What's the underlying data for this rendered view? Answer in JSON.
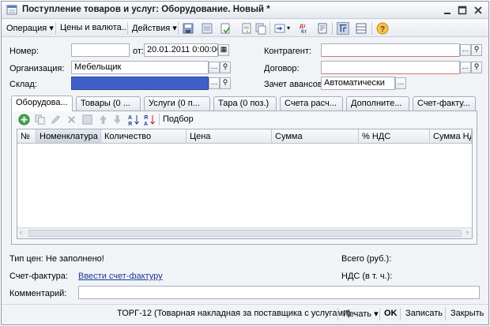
{
  "window": {
    "title": "Поступление товаров и услуг: Оборудование. Новый *"
  },
  "toolbar": {
    "operation": "Операция",
    "prices": "Цены и валюта...",
    "actions": "Действия"
  },
  "header": {
    "number_label": "Номер:",
    "number_value": "",
    "date_label": "от:",
    "date_value": "20.01.2011  0:00:00",
    "org_label": "Организация:",
    "org_value": "Мебельщик",
    "warehouse_label": "Склад:",
    "warehouse_value": "",
    "counterparty_label": "Контрагент:",
    "counterparty_value": "",
    "contract_label": "Договор:",
    "contract_value": "",
    "advance_label": "Зачет авансов:",
    "advance_value": "Автоматически"
  },
  "tabs": [
    {
      "label": "Оборудова..."
    },
    {
      "label": "Товары (0 ..."
    },
    {
      "label": "Услуги (0 п..."
    },
    {
      "label": "Тара (0 поз.)"
    },
    {
      "label": "Счета расч..."
    },
    {
      "label": "Дополните..."
    },
    {
      "label": "Счет-факту..."
    }
  ],
  "table": {
    "pick_label": "Подбор",
    "columns": [
      "№",
      "Номенклатура",
      "Количество",
      "Цена",
      "Сумма",
      "% НДС",
      "Сумма НДС"
    ]
  },
  "footer": {
    "price_type": "Тип цен: Не заполнено!",
    "total_label": "Всего (руб.):",
    "invoice_label": "Счет-фактура:",
    "invoice_link": "Ввести счет-фактуру",
    "vat_label": "НДС (в т. ч.):",
    "comment_label": "Комментарий:",
    "comment_value": ""
  },
  "bottom": {
    "torg": "ТОРГ-12 (Товарная накладная за поставщика с услугами)",
    "print": "Печать",
    "ok": "OK",
    "save": "Записать",
    "close": "Закрыть"
  }
}
